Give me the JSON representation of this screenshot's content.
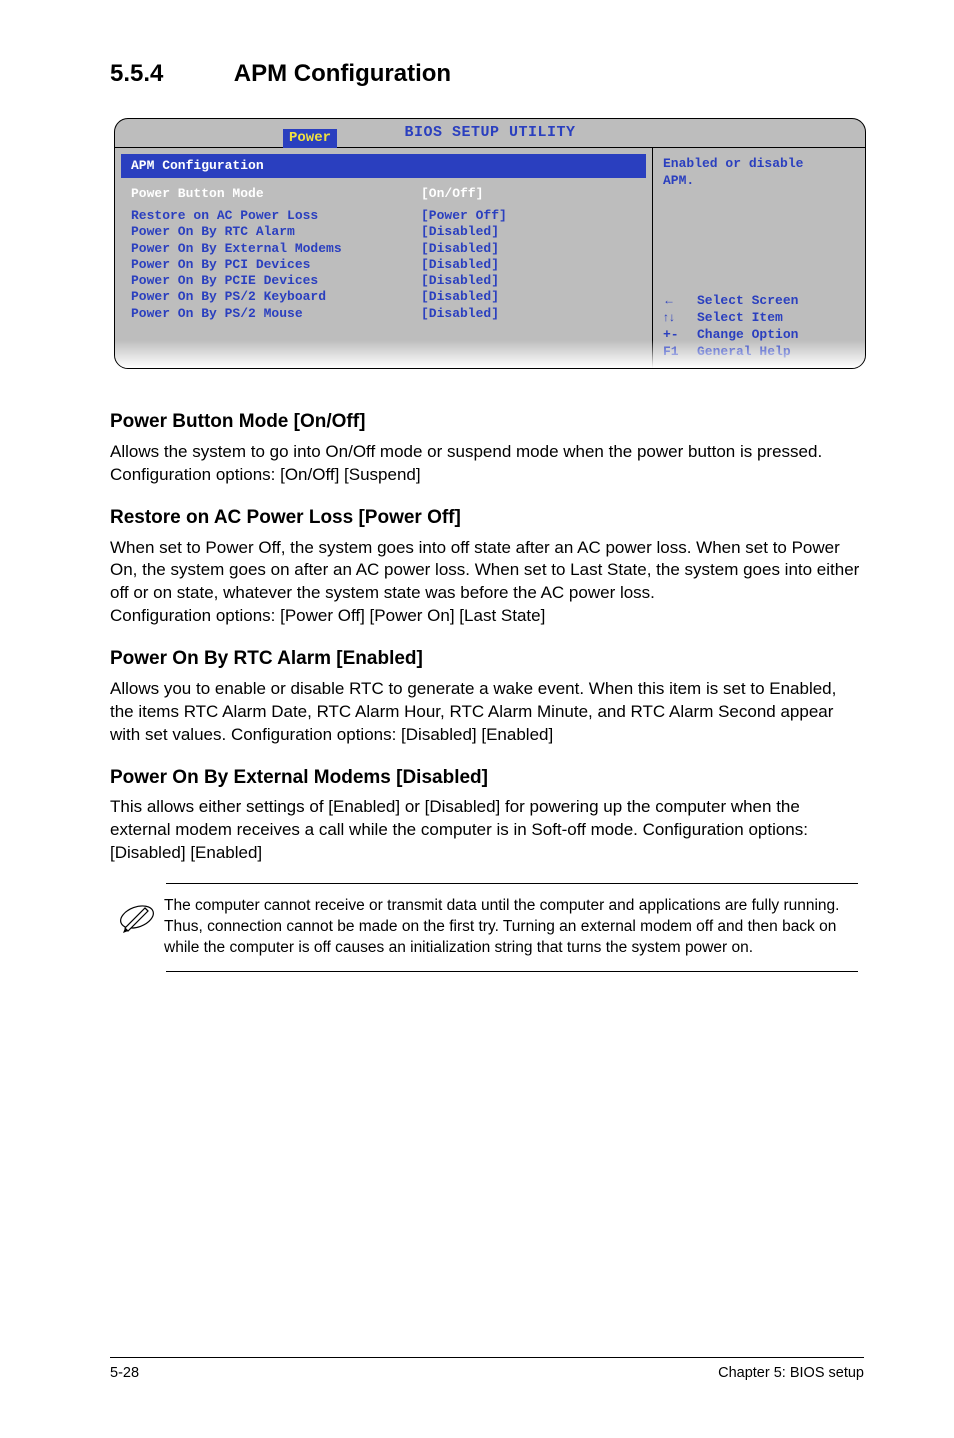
{
  "section": {
    "number": "5.5.4",
    "title": "APM Configuration"
  },
  "bios": {
    "titlebar": "BIOS SETUP UTILITY",
    "tab": "Power",
    "subhead": "APM Configuration",
    "rows": [
      {
        "label": "Power Button Mode",
        "value": "[On/Off]",
        "hl": true
      },
      {
        "spacer": true
      },
      {
        "label": "Restore on AC Power Loss",
        "value": "[Power Off]"
      },
      {
        "label": "Power On By RTC Alarm",
        "value": "[Disabled]"
      },
      {
        "label": "Power On By External Modems",
        "value": "[Disabled]"
      },
      {
        "label": "Power On By PCI Devices",
        "value": "[Disabled]"
      },
      {
        "label": "Power On By PCIE Devices",
        "value": "[Disabled]"
      },
      {
        "label": "Power On By PS/2 Keyboard",
        "value": "[Disabled]"
      },
      {
        "label": "Power On By PS/2 Mouse",
        "value": "[Disabled]"
      }
    ],
    "help_top_l1": "Enabled or disable",
    "help_top_l2": "APM.",
    "keys": [
      {
        "sym": "←",
        "txt": "Select Screen"
      },
      {
        "sym": "↑↓",
        "txt": "Select Item"
      },
      {
        "sym": "+-",
        "txt": "Change Option"
      },
      {
        "sym": "F1",
        "txt": "General Help"
      }
    ]
  },
  "h3_1": "Power Button Mode [On/Off]",
  "p1": "Allows the system to go into On/Off mode or suspend mode when the power button is pressed. Configuration options: [On/Off] [Suspend]",
  "h3_2": "Restore on AC Power Loss [Power Off]",
  "p2a": "When set to Power Off, the system goes into off state after an AC power loss. When set to Power On, the system goes on after an AC power loss. When set to Last State, the system goes into either off or on state, whatever the system state was before the AC power loss.",
  "p2b": "Configuration options: [Power Off] [Power On] [Last State]",
  "h3_3": "Power On By RTC Alarm [Enabled]",
  "p3": "Allows you to enable or disable RTC to generate a wake event. When this item is set to Enabled, the items RTC Alarm Date, RTC Alarm Hour, RTC Alarm Minute, and RTC Alarm Second appear with set values. Configuration options: [Disabled] [Enabled]",
  "h3_4": "Power On By External Modems [Disabled]",
  "p4": "This allows either settings of [Enabled] or [Disabled] for powering up the computer when the external modem receives a call while the computer is in Soft-off mode. Configuration options: [Disabled] [Enabled]",
  "note": "The computer cannot receive or transmit data until the computer and applications are fully running. Thus, connection cannot be made on the first try. Turning an external modem off and then back on while the computer is off causes an initialization string that turns the system power on.",
  "footer": {
    "left": "5-28",
    "right": "Chapter 5: BIOS setup"
  }
}
